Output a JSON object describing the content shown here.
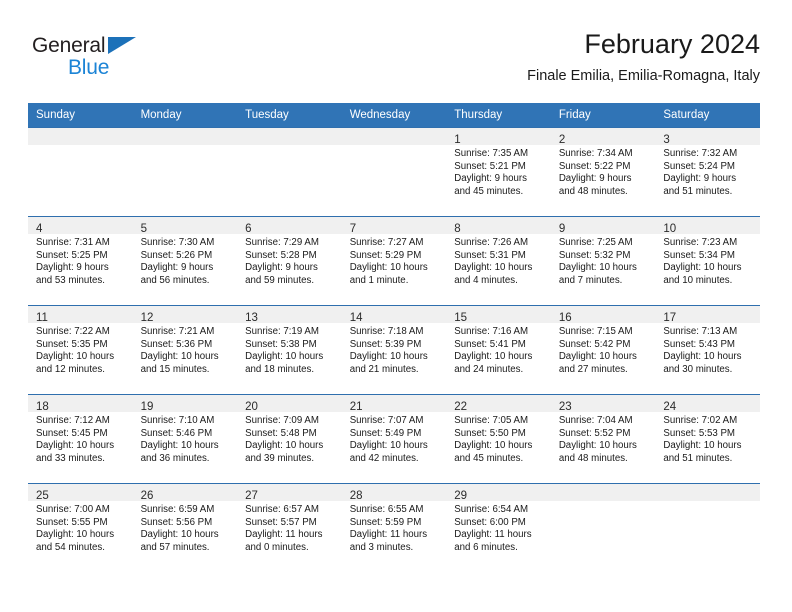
{
  "logo": {
    "text_primary": "General",
    "text_secondary": "Blue",
    "triangle_icon": "triangle-icon",
    "color_primary": "#231f20",
    "color_secondary": "#1c84d6",
    "triangle_color": "#1c71b9"
  },
  "header": {
    "title": "February 2024",
    "subtitle": "Finale Emilia, Emilia-Romagna, Italy"
  },
  "theme": {
    "header_row_bg": "#3074b6",
    "row_divider": "#2f6fae",
    "daynum_band_bg": "#f0f0f0"
  },
  "calendar": {
    "weekday_headers": [
      "Sunday",
      "Monday",
      "Tuesday",
      "Wednesday",
      "Thursday",
      "Friday",
      "Saturday"
    ],
    "weeks": [
      [
        {
          "day": "",
          "lines": []
        },
        {
          "day": "",
          "lines": []
        },
        {
          "day": "",
          "lines": []
        },
        {
          "day": "",
          "lines": []
        },
        {
          "day": "1",
          "lines": [
            "Sunrise: 7:35 AM",
            "Sunset: 5:21 PM",
            "Daylight: 9 hours",
            "and 45 minutes."
          ]
        },
        {
          "day": "2",
          "lines": [
            "Sunrise: 7:34 AM",
            "Sunset: 5:22 PM",
            "Daylight: 9 hours",
            "and 48 minutes."
          ]
        },
        {
          "day": "3",
          "lines": [
            "Sunrise: 7:32 AM",
            "Sunset: 5:24 PM",
            "Daylight: 9 hours",
            "and 51 minutes."
          ]
        }
      ],
      [
        {
          "day": "4",
          "lines": [
            "Sunrise: 7:31 AM",
            "Sunset: 5:25 PM",
            "Daylight: 9 hours",
            "and 53 minutes."
          ]
        },
        {
          "day": "5",
          "lines": [
            "Sunrise: 7:30 AM",
            "Sunset: 5:26 PM",
            "Daylight: 9 hours",
            "and 56 minutes."
          ]
        },
        {
          "day": "6",
          "lines": [
            "Sunrise: 7:29 AM",
            "Sunset: 5:28 PM",
            "Daylight: 9 hours",
            "and 59 minutes."
          ]
        },
        {
          "day": "7",
          "lines": [
            "Sunrise: 7:27 AM",
            "Sunset: 5:29 PM",
            "Daylight: 10 hours",
            "and 1 minute."
          ]
        },
        {
          "day": "8",
          "lines": [
            "Sunrise: 7:26 AM",
            "Sunset: 5:31 PM",
            "Daylight: 10 hours",
            "and 4 minutes."
          ]
        },
        {
          "day": "9",
          "lines": [
            "Sunrise: 7:25 AM",
            "Sunset: 5:32 PM",
            "Daylight: 10 hours",
            "and 7 minutes."
          ]
        },
        {
          "day": "10",
          "lines": [
            "Sunrise: 7:23 AM",
            "Sunset: 5:34 PM",
            "Daylight: 10 hours",
            "and 10 minutes."
          ]
        }
      ],
      [
        {
          "day": "11",
          "lines": [
            "Sunrise: 7:22 AM",
            "Sunset: 5:35 PM",
            "Daylight: 10 hours",
            "and 12 minutes."
          ]
        },
        {
          "day": "12",
          "lines": [
            "Sunrise: 7:21 AM",
            "Sunset: 5:36 PM",
            "Daylight: 10 hours",
            "and 15 minutes."
          ]
        },
        {
          "day": "13",
          "lines": [
            "Sunrise: 7:19 AM",
            "Sunset: 5:38 PM",
            "Daylight: 10 hours",
            "and 18 minutes."
          ]
        },
        {
          "day": "14",
          "lines": [
            "Sunrise: 7:18 AM",
            "Sunset: 5:39 PM",
            "Daylight: 10 hours",
            "and 21 minutes."
          ]
        },
        {
          "day": "15",
          "lines": [
            "Sunrise: 7:16 AM",
            "Sunset: 5:41 PM",
            "Daylight: 10 hours",
            "and 24 minutes."
          ]
        },
        {
          "day": "16",
          "lines": [
            "Sunrise: 7:15 AM",
            "Sunset: 5:42 PM",
            "Daylight: 10 hours",
            "and 27 minutes."
          ]
        },
        {
          "day": "17",
          "lines": [
            "Sunrise: 7:13 AM",
            "Sunset: 5:43 PM",
            "Daylight: 10 hours",
            "and 30 minutes."
          ]
        }
      ],
      [
        {
          "day": "18",
          "lines": [
            "Sunrise: 7:12 AM",
            "Sunset: 5:45 PM",
            "Daylight: 10 hours",
            "and 33 minutes."
          ]
        },
        {
          "day": "19",
          "lines": [
            "Sunrise: 7:10 AM",
            "Sunset: 5:46 PM",
            "Daylight: 10 hours",
            "and 36 minutes."
          ]
        },
        {
          "day": "20",
          "lines": [
            "Sunrise: 7:09 AM",
            "Sunset: 5:48 PM",
            "Daylight: 10 hours",
            "and 39 minutes."
          ]
        },
        {
          "day": "21",
          "lines": [
            "Sunrise: 7:07 AM",
            "Sunset: 5:49 PM",
            "Daylight: 10 hours",
            "and 42 minutes."
          ]
        },
        {
          "day": "22",
          "lines": [
            "Sunrise: 7:05 AM",
            "Sunset: 5:50 PM",
            "Daylight: 10 hours",
            "and 45 minutes."
          ]
        },
        {
          "day": "23",
          "lines": [
            "Sunrise: 7:04 AM",
            "Sunset: 5:52 PM",
            "Daylight: 10 hours",
            "and 48 minutes."
          ]
        },
        {
          "day": "24",
          "lines": [
            "Sunrise: 7:02 AM",
            "Sunset: 5:53 PM",
            "Daylight: 10 hours",
            "and 51 minutes."
          ]
        }
      ],
      [
        {
          "day": "25",
          "lines": [
            "Sunrise: 7:00 AM",
            "Sunset: 5:55 PM",
            "Daylight: 10 hours",
            "and 54 minutes."
          ]
        },
        {
          "day": "26",
          "lines": [
            "Sunrise: 6:59 AM",
            "Sunset: 5:56 PM",
            "Daylight: 10 hours",
            "and 57 minutes."
          ]
        },
        {
          "day": "27",
          "lines": [
            "Sunrise: 6:57 AM",
            "Sunset: 5:57 PM",
            "Daylight: 11 hours",
            "and 0 minutes."
          ]
        },
        {
          "day": "28",
          "lines": [
            "Sunrise: 6:55 AM",
            "Sunset: 5:59 PM",
            "Daylight: 11 hours",
            "and 3 minutes."
          ]
        },
        {
          "day": "29",
          "lines": [
            "Sunrise: 6:54 AM",
            "Sunset: 6:00 PM",
            "Daylight: 11 hours",
            "and 6 minutes."
          ]
        },
        {
          "day": "",
          "lines": []
        },
        {
          "day": "",
          "lines": []
        }
      ]
    ]
  }
}
